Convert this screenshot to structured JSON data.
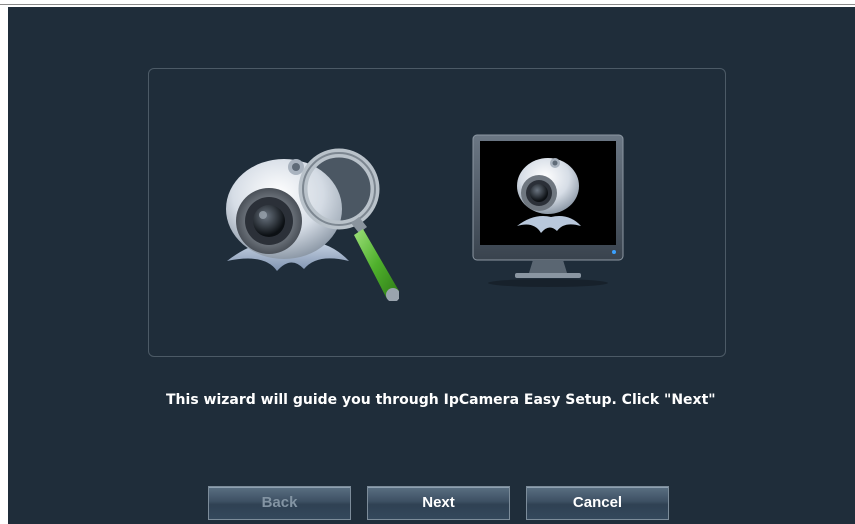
{
  "wizard": {
    "message": "This wizard will guide you through IpCamera Easy Setup. Click \"Next\"",
    "images": {
      "search_icon": "camera-search-icon",
      "monitor_icon": "camera-monitor-icon"
    }
  },
  "buttons": {
    "back": "Back",
    "next": "Next",
    "cancel": "Cancel"
  },
  "colors": {
    "background": "#1f2d3a",
    "panel_border": "#4c5a66",
    "text": "#ffffff",
    "button_gradient_top": "#5a6f82",
    "button_gradient_bottom": "#34485c",
    "magnifier_handle": "#5bbf3a"
  }
}
